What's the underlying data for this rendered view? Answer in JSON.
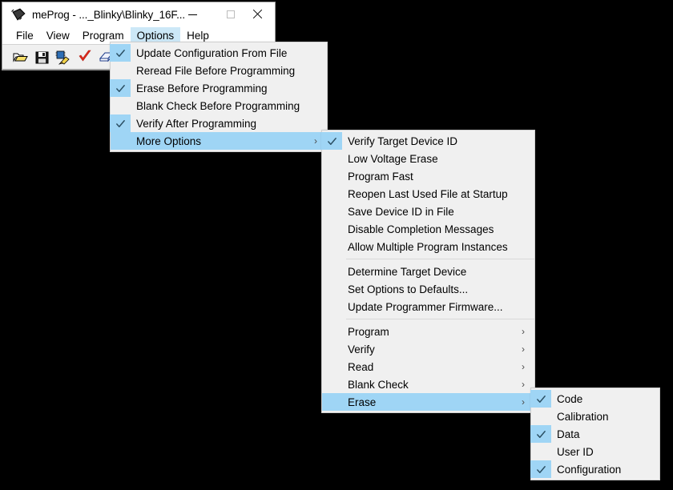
{
  "window": {
    "title": "meProg - ..._Blinky\\Blinky_16F...",
    "icon": "chip-icon",
    "controls": {
      "minimize": "—",
      "maximize": "□",
      "close": "✕"
    }
  },
  "menubar": {
    "items": [
      {
        "label": "File",
        "active": false
      },
      {
        "label": "View",
        "active": false
      },
      {
        "label": "Program",
        "active": false
      },
      {
        "label": "Options",
        "active": true
      },
      {
        "label": "Help",
        "active": false
      }
    ]
  },
  "toolbar": {
    "buttons": [
      {
        "name": "open-file-icon",
        "title": "Open"
      },
      {
        "name": "save-file-icon",
        "title": "Save"
      },
      {
        "name": "program-device-icon",
        "title": "Program"
      },
      {
        "name": "verify-icon",
        "title": "Verify"
      },
      {
        "name": "erase-icon",
        "title": "Erase"
      },
      {
        "name": "blank-check-icon",
        "title": "Blank Check"
      }
    ]
  },
  "options_menu": {
    "items": [
      {
        "label": "Update Configuration From File",
        "checked": true,
        "submenu": false,
        "highlighted": false
      },
      {
        "label": "Reread File Before Programming",
        "checked": false,
        "submenu": false,
        "highlighted": false
      },
      {
        "label": "Erase Before Programming",
        "checked": true,
        "submenu": false,
        "highlighted": false
      },
      {
        "label": "Blank Check Before Programming",
        "checked": false,
        "submenu": false,
        "highlighted": false
      },
      {
        "label": "Verify After Programming",
        "checked": true,
        "submenu": false,
        "highlighted": false
      },
      {
        "label": "More Options",
        "checked": false,
        "submenu": true,
        "highlighted": true
      }
    ]
  },
  "more_options_menu": {
    "groups": [
      {
        "items": [
          {
            "label": "Verify Target Device ID",
            "checked": true,
            "submenu": false,
            "highlighted": false
          },
          {
            "label": "Low Voltage Erase",
            "checked": false,
            "submenu": false,
            "highlighted": false
          },
          {
            "label": "Program Fast",
            "checked": false,
            "submenu": false,
            "highlighted": false
          },
          {
            "label": "Reopen Last Used File at Startup",
            "checked": false,
            "submenu": false,
            "highlighted": false
          },
          {
            "label": "Save Device ID in File",
            "checked": false,
            "submenu": false,
            "highlighted": false
          },
          {
            "label": "Disable Completion Messages",
            "checked": false,
            "submenu": false,
            "highlighted": false
          },
          {
            "label": "Allow Multiple Program Instances",
            "checked": false,
            "submenu": false,
            "highlighted": false
          }
        ]
      },
      {
        "items": [
          {
            "label": "Determine Target Device",
            "checked": false,
            "submenu": false,
            "highlighted": false
          },
          {
            "label": "Set Options to Defaults...",
            "checked": false,
            "submenu": false,
            "highlighted": false
          },
          {
            "label": "Update Programmer Firmware...",
            "checked": false,
            "submenu": false,
            "highlighted": false
          }
        ]
      },
      {
        "items": [
          {
            "label": "Program",
            "checked": false,
            "submenu": true,
            "highlighted": false
          },
          {
            "label": "Verify",
            "checked": false,
            "submenu": true,
            "highlighted": false
          },
          {
            "label": "Read",
            "checked": false,
            "submenu": true,
            "highlighted": false
          },
          {
            "label": "Blank Check",
            "checked": false,
            "submenu": true,
            "highlighted": false
          },
          {
            "label": "Erase",
            "checked": false,
            "submenu": true,
            "highlighted": true
          }
        ]
      }
    ]
  },
  "erase_menu": {
    "items": [
      {
        "label": "Code",
        "checked": true,
        "submenu": false,
        "highlighted": false
      },
      {
        "label": "Calibration",
        "checked": false,
        "submenu": false,
        "highlighted": false
      },
      {
        "label": "Data",
        "checked": true,
        "submenu": false,
        "highlighted": false
      },
      {
        "label": "User ID",
        "checked": false,
        "submenu": false,
        "highlighted": false
      },
      {
        "label": "Configuration",
        "checked": true,
        "submenu": false,
        "highlighted": false
      }
    ]
  },
  "colors": {
    "menu_background": "#f0f0f0",
    "highlight": "#9fd5f5",
    "menubar_highlight": "#cce8f7",
    "check_mark": "#2b4f63",
    "separator": "#d8d8d8",
    "desktop": "#000000"
  },
  "glyphs": {
    "submenu_arrow": "›",
    "check": "✓"
  }
}
